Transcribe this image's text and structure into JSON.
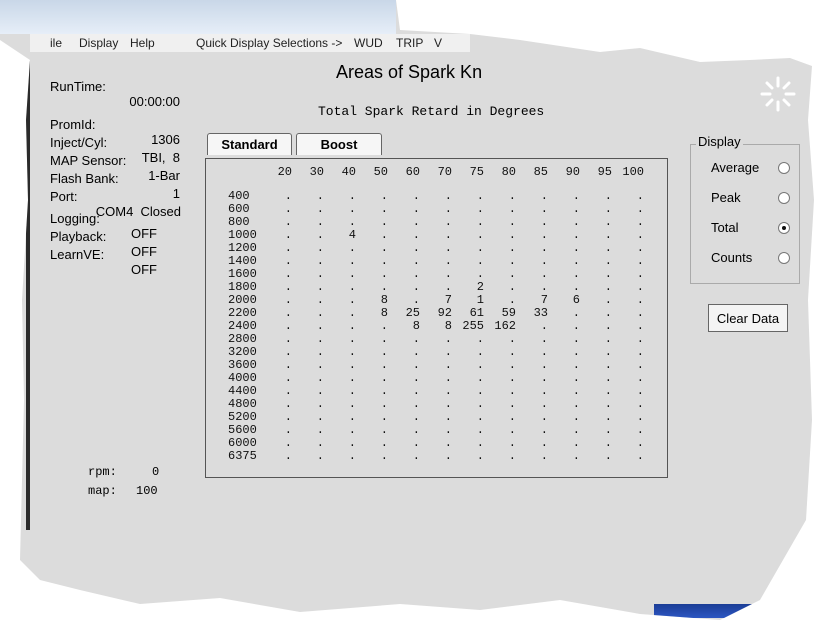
{
  "menu": [
    "ile",
    "Display",
    "Help",
    "Quick Display Selections ->",
    "WUD",
    "TRIP",
    "V"
  ],
  "status": {
    "run_time": {
      "label": "RunTime:",
      "value": "00:00:00"
    },
    "prom_id": {
      "label": "PromId:",
      "value": "1306"
    },
    "inject_cyl": {
      "label": "Inject/Cyl:",
      "value": "TBI,  8"
    },
    "map_sensor": {
      "label": "MAP Sensor:",
      "value": "1-Bar"
    },
    "flash_bank": {
      "label": "Flash Bank:",
      "value": "1"
    },
    "port": {
      "label": "Port:",
      "value": "COM4  Closed"
    },
    "logging": {
      "label": "Logging:",
      "value": "OFF"
    },
    "playback": {
      "label": "Playback:",
      "value": "OFF"
    },
    "learn_ve": {
      "label": "LearnVE:",
      "value": "OFF"
    }
  },
  "title": "Areas of Spark Kn",
  "subtitle": "Total Spark Retard in Degrees",
  "tabs": [
    "Standard",
    "Boost"
  ],
  "columns": [
    "20",
    "30",
    "40",
    "50",
    "60",
    "70",
    "75",
    "80",
    "85",
    "90",
    "95",
    "100"
  ],
  "rows": [
    {
      "rpm": "400",
      "cells": [
        ".",
        ".",
        ".",
        ".",
        ".",
        ".",
        ".",
        ".",
        ".",
        ".",
        ".",
        "."
      ]
    },
    {
      "rpm": "600",
      "cells": [
        ".",
        ".",
        ".",
        ".",
        ".",
        ".",
        ".",
        ".",
        ".",
        ".",
        ".",
        "."
      ]
    },
    {
      "rpm": "800",
      "cells": [
        ".",
        ".",
        ".",
        ".",
        ".",
        ".",
        ".",
        ".",
        ".",
        ".",
        ".",
        "."
      ]
    },
    {
      "rpm": "1000",
      "cells": [
        ".",
        ".",
        "4",
        ".",
        ".",
        ".",
        ".",
        ".",
        ".",
        ".",
        ".",
        "."
      ]
    },
    {
      "rpm": "1200",
      "cells": [
        ".",
        ".",
        ".",
        ".",
        ".",
        ".",
        ".",
        ".",
        ".",
        ".",
        ".",
        "."
      ]
    },
    {
      "rpm": "1400",
      "cells": [
        ".",
        ".",
        ".",
        ".",
        ".",
        ".",
        ".",
        ".",
        ".",
        ".",
        ".",
        "."
      ]
    },
    {
      "rpm": "1600",
      "cells": [
        ".",
        ".",
        ".",
        ".",
        ".",
        ".",
        ".",
        ".",
        ".",
        ".",
        ".",
        "."
      ]
    },
    {
      "rpm": "1800",
      "cells": [
        ".",
        ".",
        ".",
        ".",
        ".",
        ".",
        "2",
        ".",
        ".",
        ".",
        ".",
        "."
      ]
    },
    {
      "rpm": "2000",
      "cells": [
        ".",
        ".",
        ".",
        "8",
        ".",
        "7",
        "1",
        ".",
        "7",
        "6",
        ".",
        "."
      ]
    },
    {
      "rpm": "2200",
      "cells": [
        ".",
        ".",
        ".",
        "8",
        "25",
        "92",
        "61",
        "59",
        "33",
        ".",
        ".",
        "."
      ]
    },
    {
      "rpm": "2400",
      "cells": [
        ".",
        ".",
        ".",
        ".",
        "8",
        "8",
        "255",
        "162",
        ".",
        ".",
        ".",
        "."
      ]
    },
    {
      "rpm": "2800",
      "cells": [
        ".",
        ".",
        ".",
        ".",
        ".",
        ".",
        ".",
        ".",
        ".",
        ".",
        ".",
        "."
      ]
    },
    {
      "rpm": "3200",
      "cells": [
        ".",
        ".",
        ".",
        ".",
        ".",
        ".",
        ".",
        ".",
        ".",
        ".",
        ".",
        "."
      ]
    },
    {
      "rpm": "3600",
      "cells": [
        ".",
        ".",
        ".",
        ".",
        ".",
        ".",
        ".",
        ".",
        ".",
        ".",
        ".",
        "."
      ]
    },
    {
      "rpm": "4000",
      "cells": [
        ".",
        ".",
        ".",
        ".",
        ".",
        ".",
        ".",
        ".",
        ".",
        ".",
        ".",
        "."
      ]
    },
    {
      "rpm": "4400",
      "cells": [
        ".",
        ".",
        ".",
        ".",
        ".",
        ".",
        ".",
        ".",
        ".",
        ".",
        ".",
        "."
      ]
    },
    {
      "rpm": "4800",
      "cells": [
        ".",
        ".",
        ".",
        ".",
        ".",
        ".",
        ".",
        ".",
        ".",
        ".",
        ".",
        "."
      ]
    },
    {
      "rpm": "5200",
      "cells": [
        ".",
        ".",
        ".",
        ".",
        ".",
        ".",
        ".",
        ".",
        ".",
        ".",
        ".",
        "."
      ]
    },
    {
      "rpm": "5600",
      "cells": [
        ".",
        ".",
        ".",
        ".",
        ".",
        ".",
        ".",
        ".",
        ".",
        ".",
        ".",
        "."
      ]
    },
    {
      "rpm": "6000",
      "cells": [
        ".",
        ".",
        ".",
        ".",
        ".",
        ".",
        ".",
        ".",
        ".",
        ".",
        ".",
        "."
      ]
    },
    {
      "rpm": "6375",
      "cells": [
        ".",
        ".",
        ".",
        ".",
        ".",
        ".",
        ".",
        ".",
        ".",
        ".",
        ".",
        "."
      ]
    }
  ],
  "display": {
    "legend": "Display",
    "options": [
      {
        "label": "Average",
        "selected": false
      },
      {
        "label": "Peak",
        "selected": false
      },
      {
        "label": "Total",
        "selected": true
      },
      {
        "label": "Counts",
        "selected": false
      }
    ]
  },
  "clear_button": "Clear Data",
  "readouts": [
    {
      "label": "rpm:",
      "value": "0"
    },
    {
      "label": "map:",
      "value": "100"
    }
  ]
}
